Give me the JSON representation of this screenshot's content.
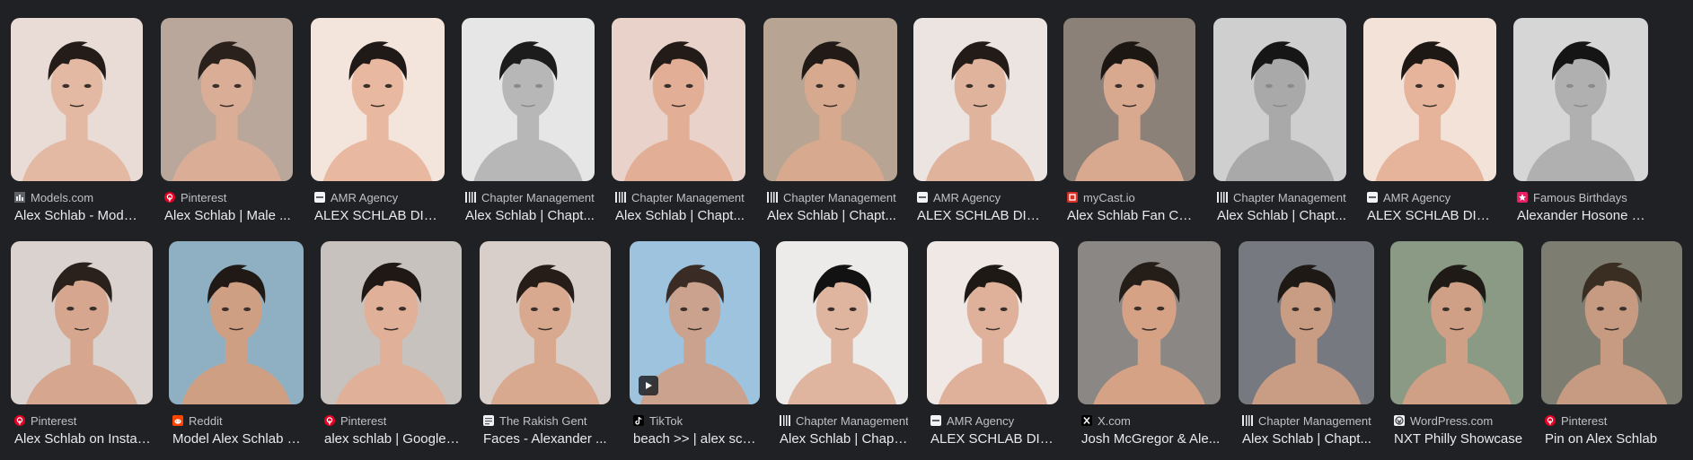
{
  "results": [
    {
      "row": 1,
      "source": "Models.com",
      "favicon": "models-favicon-icon",
      "title": "Alex Schlab - Model ...",
      "bg": "#e9dcd6",
      "tone": "#e3b9a4",
      "hair": "#231c19",
      "mono": false
    },
    {
      "row": 1,
      "source": "Pinterest",
      "favicon": "pinterest-favicon-icon",
      "title": "Alex Schlab | Male ...",
      "bg": "#b9a79b",
      "tone": "#d9ad96",
      "hair": "#2a211d",
      "mono": false
    },
    {
      "row": 1,
      "source": "AMR Agency",
      "favicon": "amr-agency-favicon-icon",
      "title": "ALEX SCHLAB DIGI...",
      "bg": "#f3e4dc",
      "tone": "#e8b9a0",
      "hair": "#1f1917",
      "mono": false
    },
    {
      "row": 1,
      "source": "Chapter Management",
      "favicon": "chapter-management-favicon-icon",
      "title": "Alex Schlab | Chapt...",
      "bg": "#e6e6e6",
      "tone": "#b7b7b7",
      "hair": "#1c1c1c",
      "mono": true
    },
    {
      "row": 1,
      "source": "Chapter Management",
      "favicon": "chapter-management-favicon-icon",
      "title": "Alex Schlab | Chapt...",
      "bg": "#e9d2ca",
      "tone": "#e2ae96",
      "hair": "#221b18",
      "mono": false
    },
    {
      "row": 1,
      "source": "Chapter Management",
      "favicon": "chapter-management-favicon-icon",
      "title": "Alex Schlab | Chapt...",
      "bg": "#b7a493",
      "tone": "#d7a98e",
      "hair": "#211a16",
      "mono": false
    },
    {
      "row": 1,
      "source": "AMR Agency",
      "favicon": "amr-agency-favicon-icon",
      "title": "ALEX SCHLAB DIGI...",
      "bg": "#ece4e0",
      "tone": "#e0b39c",
      "hair": "#231b17",
      "mono": false
    },
    {
      "row": 1,
      "source": "myCast.io",
      "favicon": "mycast-favicon-icon",
      "title": "Alex Schlab Fan Ca...",
      "bg": "#8c8178",
      "tone": "#d8a88f",
      "hair": "#1d1714",
      "mono": false
    },
    {
      "row": 1,
      "source": "Chapter Management",
      "favicon": "chapter-management-favicon-icon",
      "title": "Alex Schlab | Chapt...",
      "bg": "#cfcfcf",
      "tone": "#a9a9a9",
      "hair": "#161616",
      "mono": true
    },
    {
      "row": 1,
      "source": "AMR Agency",
      "favicon": "amr-agency-favicon-icon",
      "title": "ALEX SCHLAB DIGI...",
      "bg": "#f2e2d8",
      "tone": "#e6b49b",
      "hair": "#1e1815",
      "mono": false
    },
    {
      "row": 1,
      "source": "Famous Birthdays",
      "favicon": "famous-birthdays-favicon-icon",
      "title": "Alexander Hosone Schlab ...",
      "bg": "#d6d6d6",
      "tone": "#b0b0b0",
      "hair": "#151515",
      "mono": true
    },
    {
      "row": 2,
      "source": "Pinterest",
      "favicon": "pinterest-favicon-icon",
      "title": "Alex Schlab on Instag...",
      "bg": "#d9d2cf",
      "tone": "#d6a78e",
      "hair": "#2b211c",
      "mono": false
    },
    {
      "row": 2,
      "source": "Reddit",
      "favicon": "reddit-favicon-icon",
      "title": "Model Alex Schlab : ...",
      "bg": "#8fb0c2",
      "tone": "#cf9f84",
      "hair": "#201915",
      "mono": false
    },
    {
      "row": 2,
      "source": "Pinterest",
      "favicon": "pinterest-favicon-icon",
      "title": "alex schlab | Google i...",
      "bg": "#c7c2be",
      "tone": "#e0b098",
      "hair": "#1f1815",
      "mono": false
    },
    {
      "row": 2,
      "source": "The Rakish Gent",
      "favicon": "rakish-gent-favicon-icon",
      "title": "Faces - Alexander ...",
      "bg": "#d9cfca",
      "tone": "#d8a98f",
      "hair": "#261d19",
      "mono": false
    },
    {
      "row": 2,
      "source": "TikTok",
      "favicon": "tiktok-favicon-icon",
      "title": "beach >> | alex schl...",
      "bg": "#9ec3de",
      "tone": "#caa28d",
      "hair": "#3a2c25",
      "mono": false
    },
    {
      "row": 2,
      "source": "Chapter Management",
      "favicon": "chapter-management-favicon-icon",
      "title": "Alex Schlab | Chapt...",
      "bg": "#ecebea",
      "tone": "#e0b59f",
      "hair": "#121212",
      "mono": false
    },
    {
      "row": 2,
      "source": "AMR Agency",
      "favicon": "amr-agency-favicon-icon",
      "title": "ALEX SCHLAB DIGIT...",
      "bg": "#efe8e4",
      "tone": "#dfb19a",
      "hair": "#1f1916",
      "mono": false
    },
    {
      "row": 2,
      "source": "X.com",
      "favicon": "x-favicon-icon",
      "title": "Josh McGregor & Ale...",
      "bg": "#8a8784",
      "tone": "#d5a285",
      "hair": "#251d18",
      "mono": false
    },
    {
      "row": 2,
      "source": "Chapter Management",
      "favicon": "chapter-management-favicon-icon",
      "title": "Alex Schlab | Chapt...",
      "bg": "#767a80",
      "tone": "#c99c84",
      "hair": "#1f1915",
      "mono": false
    },
    {
      "row": 2,
      "source": "WordPress.com",
      "favicon": "wordpress-favicon-icon",
      "title": "NXT Philly Showcase",
      "bg": "#8a9a84",
      "tone": "#cf9f86",
      "hair": "#201a17",
      "mono": false
    },
    {
      "row": 2,
      "source": "Pinterest",
      "favicon": "pinterest-favicon-icon",
      "title": "Pin on Alex Schlab",
      "bg": "#7e7d72",
      "tone": "#c69b82",
      "hair": "#3a2d22",
      "mono": false
    }
  ],
  "tiktok_video_badge": "play-icon"
}
